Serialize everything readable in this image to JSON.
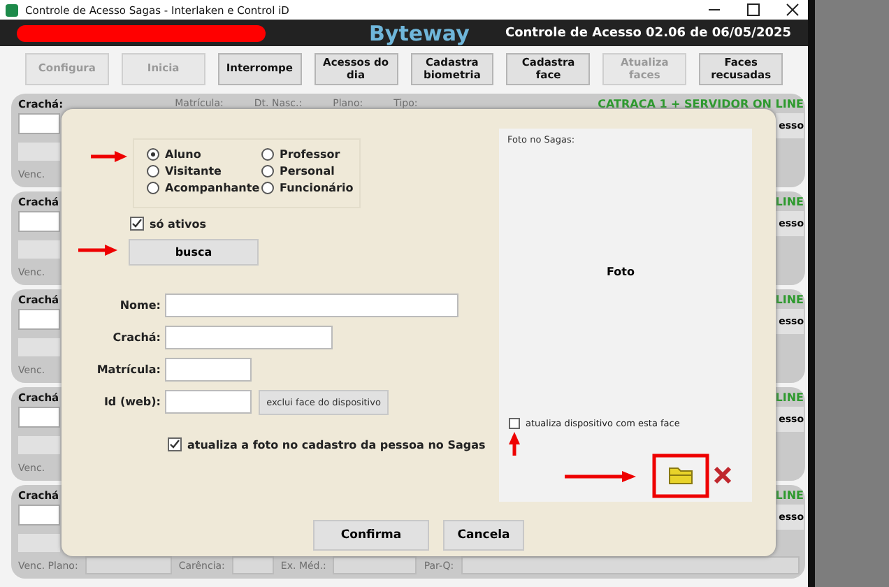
{
  "window": {
    "title": "Controle de Acesso Sagas - Interlaken e Control iD"
  },
  "header": {
    "brand": "Byteway",
    "version": "Controle de Acesso 02.06 de 06/05/2025"
  },
  "toolbar": [
    {
      "label": "Configura",
      "disabled": true
    },
    {
      "label": "Inicia",
      "disabled": true
    },
    {
      "label": "Interrompe",
      "disabled": false
    },
    {
      "label": "Acessos do dia",
      "disabled": false
    },
    {
      "label": "Cadastra biometria",
      "disabled": false
    },
    {
      "label": "Cadastra face",
      "disabled": false
    },
    {
      "label": "Atualiza faces",
      "disabled": true
    },
    {
      "label": "Faces recusadas",
      "disabled": false
    }
  ],
  "panels": [
    {
      "badge_label": "Crachá:",
      "columns": [
        "Matrícula:",
        "Dt. Nasc.:",
        "Plano:",
        "Tipo:"
      ],
      "status": "CATRACA 1 + SERVIDOR ON LINE",
      "action": "esso",
      "expiry_label": "Venc."
    },
    {
      "badge_label": "Crachá",
      "status": "LINE",
      "action": "esso",
      "expiry_label": "Venc."
    },
    {
      "badge_label": "Crachá",
      "status": "LINE",
      "action": "esso",
      "expiry_label": "Venc."
    },
    {
      "badge_label": "Crachá",
      "status": "LINE",
      "action": "esso",
      "expiry_label": "Venc."
    },
    {
      "badge_label": "Crachá",
      "status": "LINE",
      "action": "esso",
      "footer": [
        "Venc. Plano:",
        "Carência:",
        "Ex. Méd.:",
        "Par-Q:"
      ]
    }
  ],
  "dialog": {
    "person_types": [
      {
        "label": "Aluno",
        "selected": true
      },
      {
        "label": "Professor",
        "selected": false
      },
      {
        "label": "Visitante",
        "selected": false
      },
      {
        "label": "Personal",
        "selected": false
      },
      {
        "label": "Acompanhante",
        "selected": false
      },
      {
        "label": "Funcionário",
        "selected": false
      }
    ],
    "only_active": {
      "label": "só ativos",
      "checked": true
    },
    "search_button": "busca",
    "fields": [
      {
        "label": "Nome:"
      },
      {
        "label": "Crachá:"
      },
      {
        "label": "Matrícula:"
      },
      {
        "label": "Id (web):",
        "button": "exclui face do dispositivo"
      }
    ],
    "update_photo": {
      "label": "atualiza a foto no cadastro da pessoa no Sagas",
      "checked": true
    },
    "photo_panel": {
      "title": "Foto no Sagas:",
      "placeholder_text": "Foto",
      "update_device": {
        "label": "atualiza dispositivo com esta face",
        "checked": false
      }
    },
    "buttons": [
      "Confirma",
      "Cancela"
    ]
  }
}
